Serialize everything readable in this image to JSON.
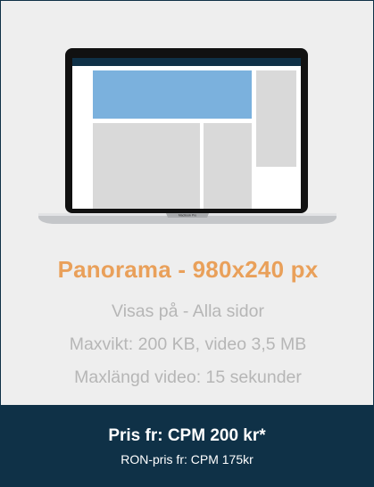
{
  "card": {
    "title": "Panorama - 980x240 px",
    "specs": [
      "Visas på - Alla sidor",
      "Maxvikt: 200 KB, video 3,5 MB",
      "Maxlängd video: 15 sekunder"
    ],
    "price": {
      "main": "Pris fr: CPM 200 kr*",
      "sub": "RON-pris fr: CPM 175kr"
    },
    "illustration": {
      "device_label": "MacBook Pro"
    }
  },
  "colors": {
    "accent": "#e9a05a",
    "footer_bg": "#0f3147",
    "card_bg": "#eeeeee",
    "spec_text": "#b6b6b6",
    "ad_highlight": "#7bb1dd",
    "placeholder": "#d9d9d9"
  }
}
